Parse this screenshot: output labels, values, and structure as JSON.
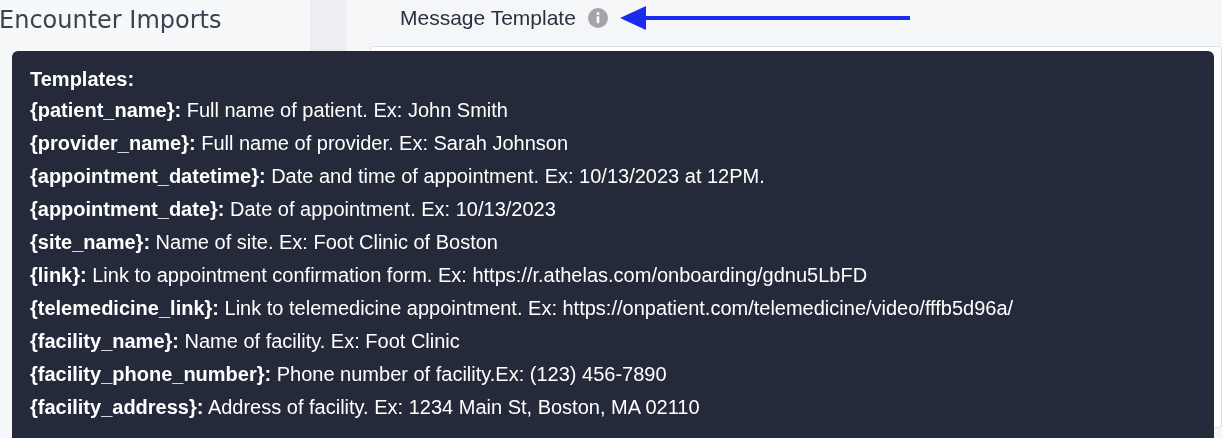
{
  "sidebar": {
    "title": "Encounter Imports"
  },
  "field": {
    "label": "Message Template"
  },
  "tooltip": {
    "title": "Templates:",
    "rows": [
      "**{patient_name}:** Full name of patient. Ex: John Smith",
      "**{provider_name}:** Full name of provider. Ex: Sarah Johnson",
      "**{appointment_datetime}:** Date and time of appointment. Ex: 10/13/2023 at 12PM.",
      "**{appointment_date}:** Date of appointment. Ex: 10/13/2023",
      "**{site_name}:** Name of site. Ex: Foot Clinic of Boston",
      "**{link}:** Link to appointment confirmation form. Ex: https://r.athelas.com/onboarding/gdnu5LbFD",
      "**{telemedicine_link}:** Link to telemedicine appointment. Ex: https://onpatient.com/telemedicine/video/fffb5d96a/",
      "**{facility_name}:** Name of facility. Ex: Foot Clinic",
      "**{facility_phone_number}:** Phone number of facility.Ex: (123) 456-7890",
      "**{facility_address}:** Address of facility. Ex: 1234 Main St, Boston, MA 02110"
    ]
  }
}
